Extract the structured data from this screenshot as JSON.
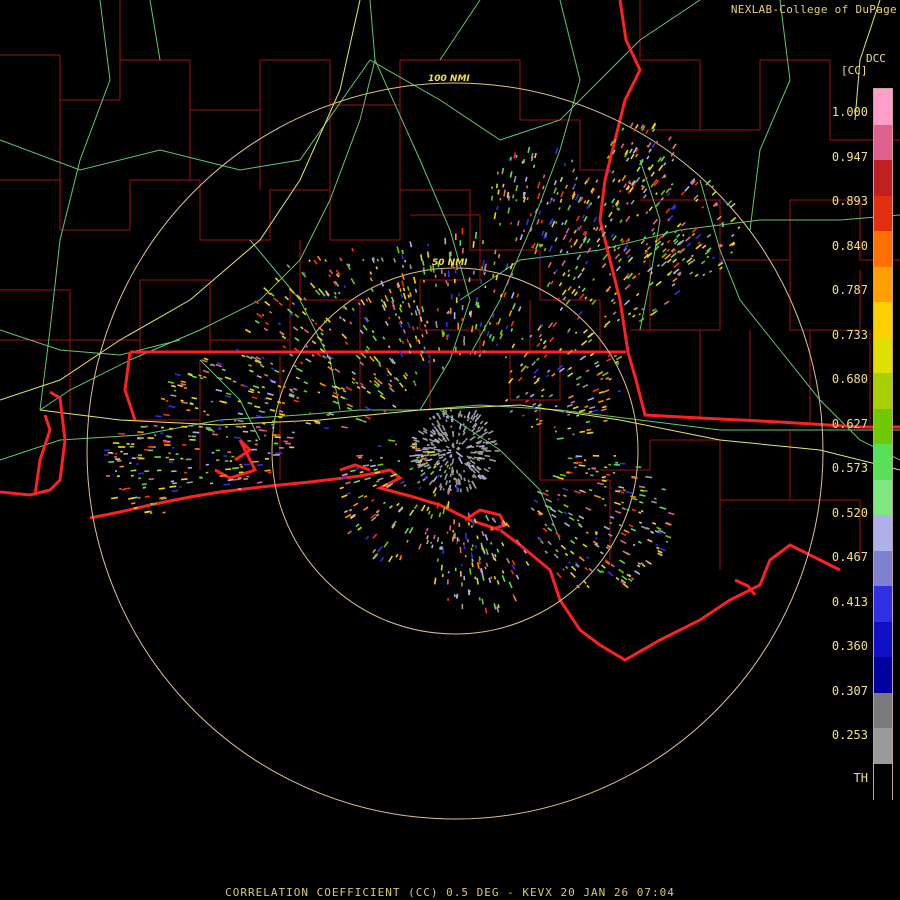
{
  "product": {
    "credit": "NEXLAB-College of DuPage",
    "dcc": "DCC",
    "units": "[CC]",
    "footer": "CORRELATION COEFFICIENT (CC) 0.5 DEG - KEVX 20 JAN 26 07:04"
  },
  "range_rings": [
    {
      "label": "50 NMI"
    },
    {
      "label": "100 NMI"
    }
  ],
  "legend": {
    "ticks": [
      "1.000",
      "0.947",
      "0.893",
      "0.840",
      "0.787",
      "0.733",
      "0.680",
      "0.627",
      "0.573",
      "0.520",
      "0.467",
      "0.413",
      "0.360",
      "0.307",
      "0.253",
      "TH"
    ],
    "bands": [
      {
        "color": "#ff9ec8"
      },
      {
        "color": "#e06090"
      },
      {
        "color": "#c02020"
      },
      {
        "color": "#e03010"
      },
      {
        "color": "#ff7000"
      },
      {
        "color": "#ffa000"
      },
      {
        "color": "#ffd000"
      },
      {
        "color": "#e0e000"
      },
      {
        "color": "#a8d000"
      },
      {
        "color": "#70c800"
      },
      {
        "color": "#58e058"
      },
      {
        "color": "#80e880"
      },
      {
        "color": "#b0b0e8"
      },
      {
        "color": "#8080d0"
      },
      {
        "color": "#3030e0"
      },
      {
        "color": "#1010c8"
      },
      {
        "color": "#0000a0"
      },
      {
        "color": "#7a7a7a"
      },
      {
        "color": "#9a9a9a"
      },
      {
        "color": "#000000"
      }
    ]
  },
  "colors": {
    "state_border": "#ff2020",
    "county_border": "#a01010",
    "highway": "#60c870",
    "interstate": "#e8e860",
    "range_ring": "#e0c090",
    "background": "#000000"
  },
  "radar_site": "KEVX"
}
